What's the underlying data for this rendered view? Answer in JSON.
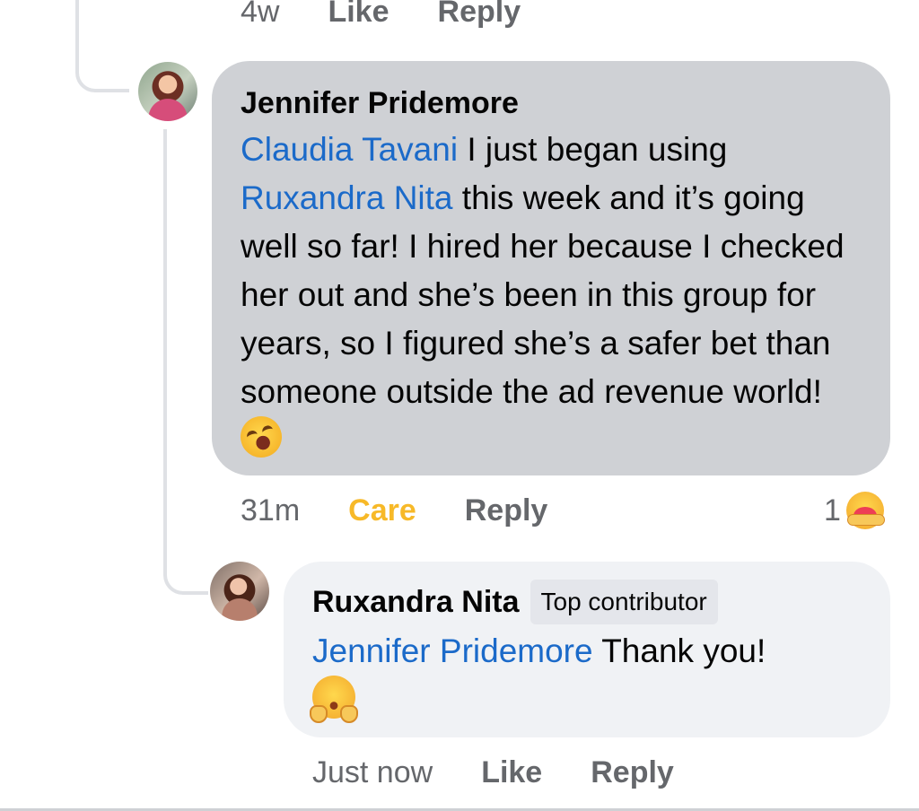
{
  "previous_comment": {
    "time": "4w",
    "like_label": "Like",
    "reply_label": "Reply"
  },
  "comment": {
    "author": "Jennifer Pridemore",
    "mention": "Claudia Tavani",
    "text_part1": " I just began using ",
    "mention2": "Ruxandra Nita",
    "text_part2": " this week and it’s going well so far! I hired her because I checked her out and she’s been in this group for years, so I figured she’s a safer bet than someone outside the ad revenue world! ",
    "emoji": "rolling-on-floor-laughing-icon",
    "time": "31m",
    "reaction_label": "Care",
    "reply_label": "Reply",
    "reaction_count": "1",
    "reaction_icon": "care-reaction-icon",
    "accent_color": "#f7b928"
  },
  "reply": {
    "author": "Ruxandra Nita",
    "badge": "Top contributor",
    "mention": "Jennifer Pridemore",
    "text": " Thank you!",
    "emoji": "hugging-face-icon",
    "time": "Just now",
    "like_label": "Like",
    "reply_label": "Reply"
  },
  "colors": {
    "mention": "#1b6ac9",
    "bubble_primary": "#cfd1d5",
    "bubble_secondary": "#f0f2f5",
    "meta_text": "#65676b"
  }
}
